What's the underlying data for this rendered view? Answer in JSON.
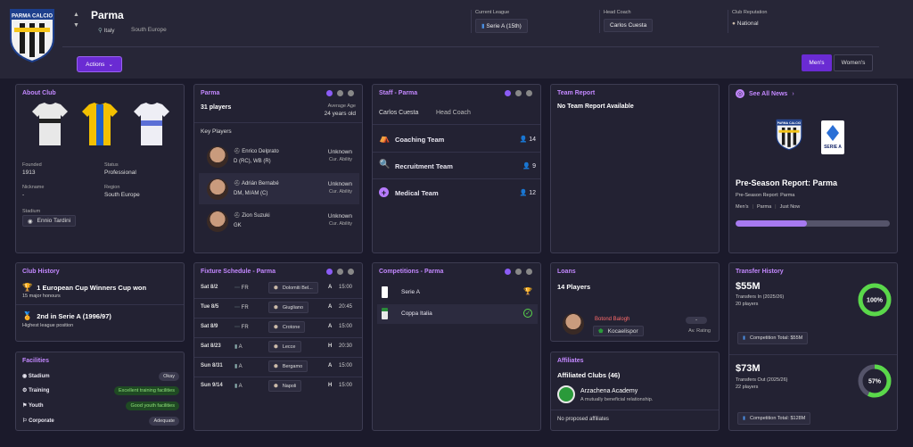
{
  "header": {
    "club_name": "Parma",
    "crest_text": "PARMA CALCIO",
    "nation": "Italy",
    "region": "South Europe",
    "current_league_label": "Current League",
    "current_league": "Serie A  (15th)",
    "head_coach_label": "Head Coach",
    "head_coach": "Carlos Cuesta",
    "reputation_label": "Club Reputation",
    "reputation": "National",
    "actions_label": "Actions",
    "mens_label": "Men's",
    "womens_label": "Women's"
  },
  "about": {
    "title": "About Club",
    "founded_label": "Founded",
    "founded": "1913",
    "status_label": "Status",
    "status": "Professional",
    "nickname_label": "Nickname",
    "nickname": "-",
    "region_label": "Region",
    "region": "South Europe",
    "stadium_label": "Stadium",
    "stadium": "Ennio Tardini"
  },
  "squad": {
    "title": "Parma",
    "players_count": "31 players",
    "avg_age_label": "Average Age",
    "avg_age": "24 years old",
    "key_players_label": "Key Players",
    "players": [
      {
        "name": "Enrico Delprato",
        "positions": "D (RC), WB (R)",
        "ability": "Unknown",
        "ability_label": "Cur. Ability"
      },
      {
        "name": "Adrián Bernabé",
        "positions": "DM, M/AM (C)",
        "ability": "Unknown",
        "ability_label": "Cur. Ability"
      },
      {
        "name": "Zion Suzuki",
        "positions": "GK",
        "ability": "Unknown",
        "ability_label": "Cur. Ability"
      }
    ]
  },
  "staff": {
    "title": "Staff - Parma",
    "coach_name": "Carlos Cuesta",
    "coach_role": "Head Coach",
    "teams": [
      {
        "label": "Coaching Team",
        "count": "14"
      },
      {
        "label": "Recruitment Team",
        "count": "9"
      },
      {
        "label": "Medical Team",
        "count": "12"
      }
    ]
  },
  "report": {
    "title": "Team Report",
    "text": "No Team Report Available"
  },
  "news": {
    "title": "See All News",
    "headline": "Pre-Season Report: Parma",
    "sub": "Pre-Season Report: Parma",
    "tag1": "Men's",
    "tag2": "Parma",
    "tag3": "Just Now",
    "crest_text": "PARMA CALCIO",
    "serie_text": "SERIE A",
    "progress": 0.46
  },
  "history": {
    "title": "Club History",
    "item1": "1 European Cup Winners Cup won",
    "item1_sub": "15  major honours",
    "item2": "2nd in Serie A (1996/97)",
    "item2_sub": "Highest league position"
  },
  "facilities": {
    "title": "Facilities",
    "rows": [
      {
        "label": "Stadium",
        "value": "Okay"
      },
      {
        "label": "Training",
        "value": "Excellent training facilities"
      },
      {
        "label": "Youth",
        "value": "Good youth facilities"
      },
      {
        "label": "Corporate",
        "value": "Adequate"
      }
    ]
  },
  "fixtures": {
    "title": "Fixture Schedule - Parma",
    "rows": [
      {
        "date": "Sat 8/2",
        "comp": "FR",
        "opponent": "Dolomiti Bel...",
        "venue": "A",
        "time": "15:00"
      },
      {
        "date": "Tue 8/5",
        "comp": "FR",
        "opponent": "Giugliano",
        "venue": "A",
        "time": "20:45"
      },
      {
        "date": "Sat 8/9",
        "comp": "FR",
        "opponent": "Crotone",
        "venue": "A",
        "time": "15:00"
      },
      {
        "date": "Sat 8/23",
        "comp": "A",
        "opponent": "Lecce",
        "venue": "H",
        "time": "20:30"
      },
      {
        "date": "Sun 8/31",
        "comp": "A",
        "opponent": "Bergamo",
        "venue": "A",
        "time": "15:00"
      },
      {
        "date": "Sun 9/14",
        "comp": "A",
        "opponent": "Napoli",
        "venue": "H",
        "time": "15:00"
      }
    ]
  },
  "competitions": {
    "title": "Competitions - Parma",
    "rows": [
      {
        "label": "Serie A"
      },
      {
        "label": "Coppa Italia"
      }
    ]
  },
  "loans": {
    "title": "Loans",
    "count": "14 Players",
    "player_name": "Botond Balogh",
    "club": "Kocaelispor",
    "rating": "-",
    "rating_label": "Av. Rating"
  },
  "affiliates": {
    "title": "Affiliates",
    "count": "Affiliated Clubs (46)",
    "club": "Arzachena Academy",
    "relation": "A mutually beneficial relationship.",
    "proposed": "No proposed affiliates"
  },
  "transfers": {
    "title": "Transfer History",
    "in_amount": "$55M",
    "in_label": "Transfers In (2025/26)",
    "in_players": "20 players",
    "in_pct_text": "100%",
    "in_pct": 1.0,
    "in_total": "Competition Total:  $55M",
    "out_amount": "$73M",
    "out_label": "Transfers Out (2025/26)",
    "out_players": "22 players",
    "out_pct_text": "57%",
    "out_pct": 0.57,
    "out_total": "Competition Total:  $128M"
  },
  "colors": {
    "accent": "#8b5cf6",
    "title": "#c388ff",
    "success": "#5ad84a"
  }
}
